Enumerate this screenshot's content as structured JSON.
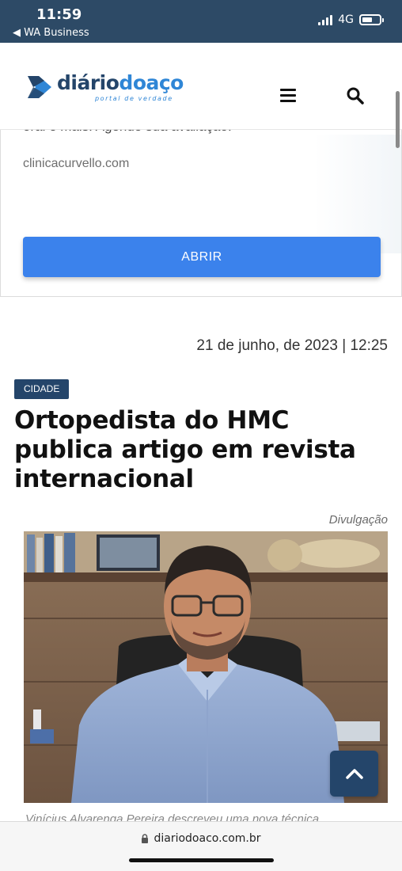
{
  "status_bar": {
    "time": "11:59",
    "back_app": "◀ WA Business",
    "network": "4G",
    "battery_level": 0.6
  },
  "header": {
    "logo_part1": "diário",
    "logo_part2": "doaço",
    "logo_tagline": "portal de verdade",
    "icons": [
      "menu-icon",
      "search-icon"
    ]
  },
  "ad": {
    "faded_text": "oral e mais. Agende sua avaliação.",
    "url": "clinicacurvello.com",
    "button_label": "ABRIR"
  },
  "article": {
    "date": "21 de junho, de 2023 | 12:25",
    "category": "CIDADE",
    "title": "Ortopedista do HMC publica artigo em revista internacional",
    "photo_credit": "Divulgação",
    "caption": "Vinícius Alvarenga Pereira descreveu uma nova técnica"
  },
  "browser": {
    "url": "diariodoaco.com.br"
  },
  "colors": {
    "brand_dark": "#24456a",
    "brand_light": "#2f86d6",
    "button_blue": "#3b82ec",
    "status_bar": "#2d4a66"
  }
}
